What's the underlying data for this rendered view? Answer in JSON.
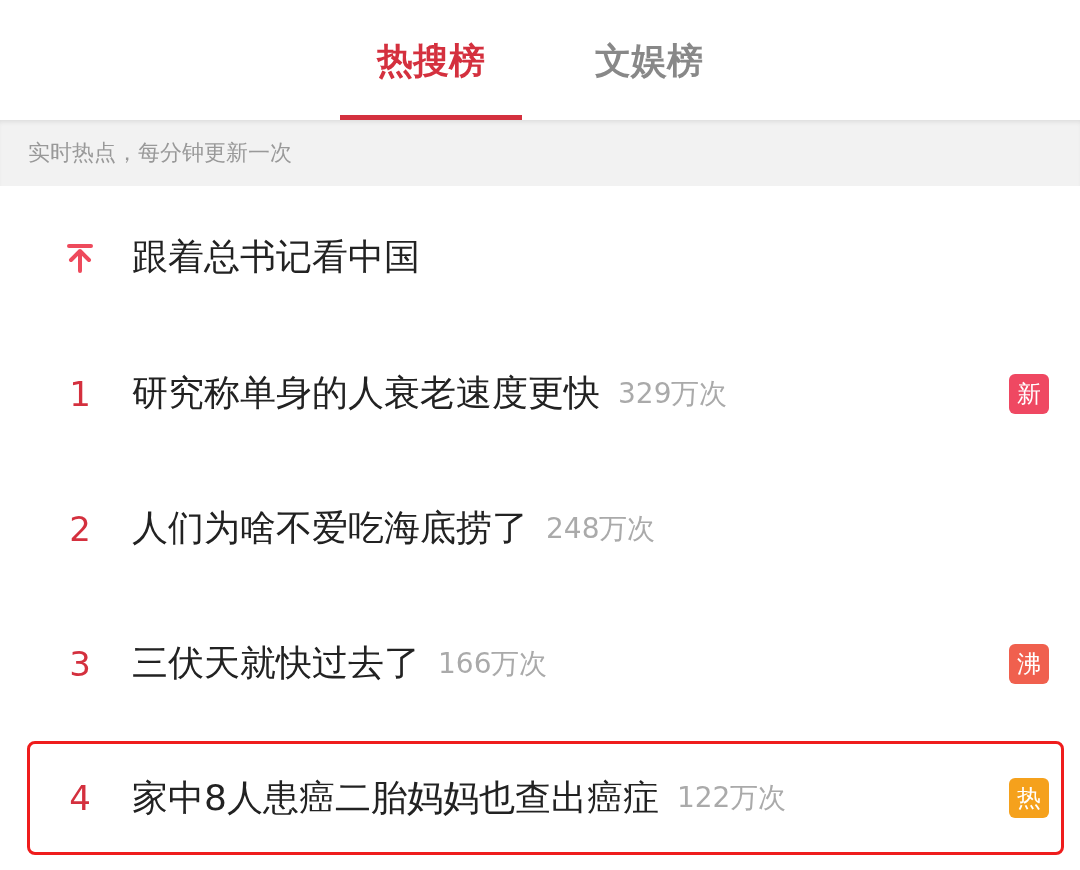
{
  "tabs": [
    {
      "label": "热搜榜",
      "selected": true
    },
    {
      "label": "文娱榜",
      "selected": false
    }
  ],
  "notice": "实时热点，每分钟更新一次",
  "items": [
    {
      "kind": "pinned",
      "title": "跟着总书记看中国",
      "highlighted": false
    },
    {
      "kind": "ranked",
      "rank": "1",
      "title": "研究称单身的人衰老速度更快",
      "count": "329万次",
      "badge": {
        "text": "新",
        "color": "#ef4862"
      },
      "highlighted": false
    },
    {
      "kind": "ranked",
      "rank": "2",
      "title": "人们为啥不爱吃海底捞了",
      "count": "248万次",
      "highlighted": false
    },
    {
      "kind": "ranked",
      "rank": "3",
      "title": "三伏天就快过去了",
      "count": "166万次",
      "badge": {
        "text": "沸",
        "color": "#f0604e"
      },
      "highlighted": false
    },
    {
      "kind": "ranked",
      "rank": "4",
      "title": "家中8人患癌二胎妈妈也查出癌症",
      "count": "122万次",
      "badge": {
        "text": "热",
        "color": "#f5a11c"
      },
      "highlighted": true
    }
  ]
}
